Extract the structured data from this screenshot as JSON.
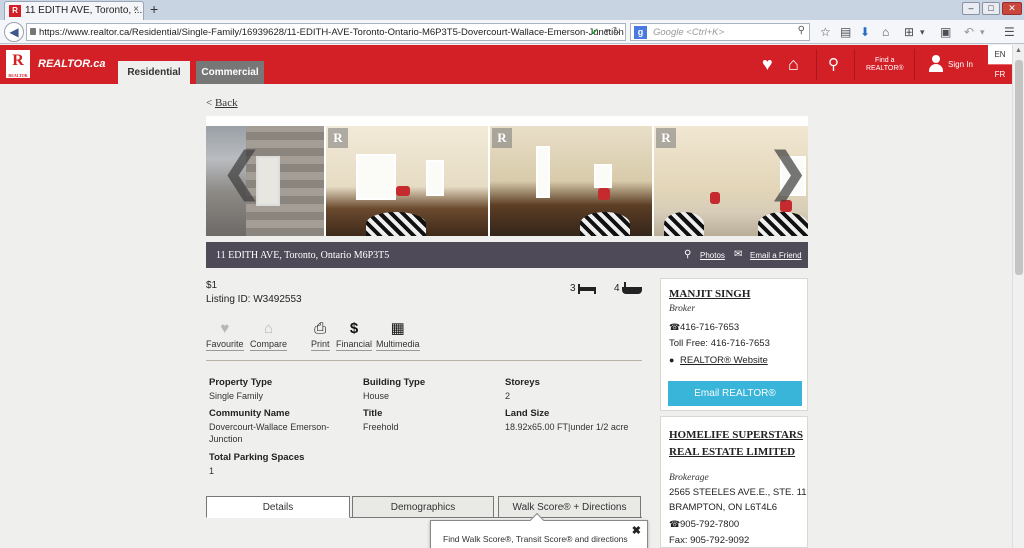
{
  "browser": {
    "tab_title": "11 EDITH AVE, Toronto, ...",
    "favicon": "R",
    "tab_close": "×",
    "new_tab": "+",
    "win_min": "–",
    "win_max": "□",
    "win_close": "✕",
    "url": "https://www.realtor.ca/Residential/Single-Family/16939628/11-EDITH-AVE-Toronto-Ontario-M6P3T5-Dovercourt-Wallace-Emerson-Junction",
    "search_engine_letter": "g",
    "search_placeholder": "Google <Ctrl+K>"
  },
  "site": {
    "brand": "REALTOR.ca",
    "logo_letter": "R",
    "logo_sub": "REALTOR",
    "nav_residential": "Residential",
    "nav_commercial": "Commercial",
    "find_realtor_line1": "Find a",
    "find_realtor_line2": "REALTOR®",
    "sign_in": "Sign In",
    "lang_en": "EN",
    "lang_fr": "FR"
  },
  "page": {
    "back_arrow": "< ",
    "back": "Back",
    "address": "11 EDITH AVE, Toronto, Ontario  M6P3T5",
    "photos_link": "Photos",
    "email_friend_link": "Email a Friend",
    "watermark": "R",
    "price": "$1",
    "listing_id": "Listing ID: W3492553",
    "beds": "3",
    "baths": "4",
    "actions": {
      "favourite": "Favourite",
      "compare": "Compare",
      "print": "Print",
      "financial": "Financial",
      "multimedia": "Multimedia"
    },
    "facts": {
      "property_type_label": "Property Type",
      "property_type": "Single Family",
      "building_type_label": "Building Type",
      "building_type": "House",
      "storeys_label": "Storeys",
      "storeys": "2",
      "community_label": "Community Name",
      "community": "Dovercourt-Wallace Emerson-Junction",
      "title_label": "Title",
      "title": "Freehold",
      "land_size_label": "Land Size",
      "land_size": "18.92x65.00 FT|under 1/2 acre",
      "parking_label": "Total Parking Spaces",
      "parking": "1"
    },
    "tabs": {
      "details": "Details",
      "demographics": "Demographics",
      "walk_score": "Walk Score® + Directions"
    },
    "popup_close": "✖",
    "popup_text": "Find Walk Score®, Transit Score® and directions"
  },
  "agent": {
    "name": "MANJIT SINGH",
    "title": "Broker",
    "phone": "416-716-7653",
    "toll_free": "Toll Free: 416-716-7653",
    "website": "REALTOR® Website",
    "email_button": "Email REALTOR®"
  },
  "brokerage": {
    "name": "HOMELIFE SUPERSTARS REAL ESTATE LIMITED",
    "title": "Brokerage",
    "address1": "2565 STEELES AVE.E., STE. 11",
    "address2": "BRAMPTON, ON  L6T4L6",
    "phone": "905-792-7800",
    "fax": "Fax: 905-792-9092"
  },
  "colors": {
    "brand_red": "#d32027",
    "address_bar": "#4f4a58",
    "email_button": "#38b5d9"
  },
  "icons": [
    "heart-icon",
    "home-icon",
    "search-icon",
    "user-icon",
    "phone-icon",
    "globe-icon",
    "bed-icon",
    "bath-icon",
    "printer-icon",
    "dollar-icon",
    "multimedia-icon",
    "close-icon",
    "mail-icon"
  ]
}
